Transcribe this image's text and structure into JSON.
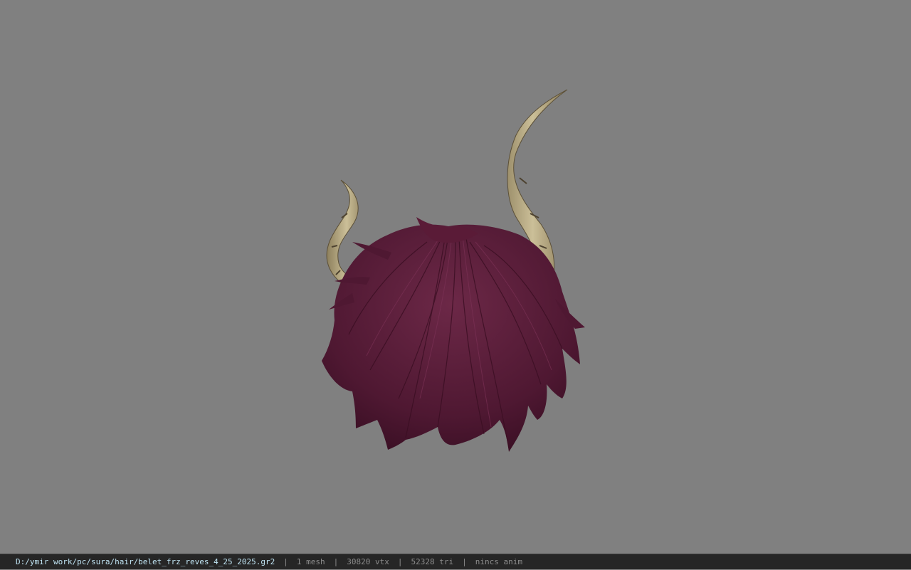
{
  "viewport": {
    "background_color": "#808080",
    "model_description_icon": "hair-with-horns-model",
    "hair_color": "#5a1e3a",
    "horn_color": "#b9ab86"
  },
  "status_bar": {
    "file_path": "D:/ymir work/pc/sura/hair/belet_frz_reves_4_25_2025.gr2",
    "separator": "|",
    "mesh_count": "1 mesh",
    "vertex_count": "30820 vtx",
    "triangle_count": "52328 tri",
    "anim_status": "nincs anim"
  }
}
